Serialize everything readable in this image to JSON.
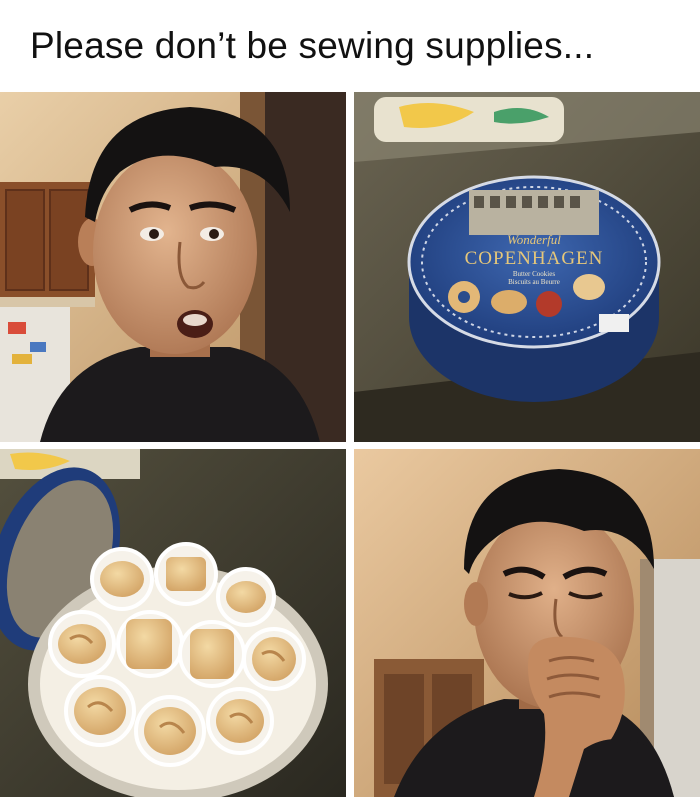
{
  "caption": "Please don’t be sewing supplies...",
  "panels": [
    {
      "description_icon": "surprised-face-photo"
    },
    {
      "description_icon": "cookie-tin-photo",
      "tin_text": {
        "brand_line1": "Wonderful",
        "brand_line2": "COPENHAGEN",
        "sub_line1": "Butter Cookies",
        "sub_line2": "Biscuits au Beurre"
      }
    },
    {
      "description_icon": "open-cookie-tin-photo"
    },
    {
      "description_icon": "crying-face-photo"
    }
  ]
}
